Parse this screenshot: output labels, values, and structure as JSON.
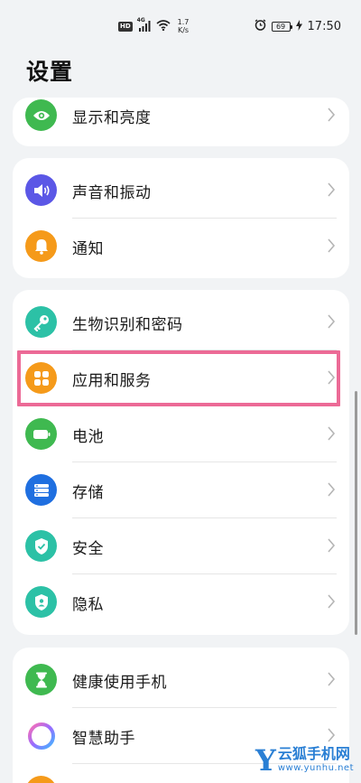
{
  "status_bar": {
    "hd_label": "HD",
    "network_tag": "4G",
    "speed_value": "1.7",
    "speed_unit": "K/s",
    "battery_level": "69",
    "time": "17:50"
  },
  "page_title": "设置",
  "cards": [
    {
      "items": [
        {
          "label": "显示和亮度",
          "icon": "eye-icon",
          "color": "#3fb950"
        }
      ]
    },
    {
      "items": [
        {
          "label": "声音和振动",
          "icon": "speaker-icon",
          "color": "#5b57e6"
        },
        {
          "label": "通知",
          "icon": "bell-icon",
          "color": "#f59a1a"
        }
      ]
    },
    {
      "items": [
        {
          "label": "生物识别和密码",
          "icon": "key-icon",
          "color": "#2cc1a6"
        },
        {
          "label": "应用和服务",
          "icon": "apps-grid-icon",
          "color": "#f59a1a"
        },
        {
          "label": "电池",
          "icon": "battery-icon",
          "color": "#3fb950"
        },
        {
          "label": "存储",
          "icon": "storage-icon",
          "color": "#1f6fe0"
        },
        {
          "label": "安全",
          "icon": "shield-check-icon",
          "color": "#2cc1a6"
        },
        {
          "label": "隐私",
          "icon": "privacy-shield-icon",
          "color": "#2cc1a6"
        }
      ]
    },
    {
      "items": [
        {
          "label": "健康使用手机",
          "icon": "hourglass-icon",
          "color": "#3fb950"
        },
        {
          "label": "智慧助手",
          "icon": "assistant-ring-icon",
          "color": "#ffffff"
        }
      ]
    }
  ],
  "highlighted_item": "应用和服务",
  "watermark": {
    "logo_letter": "Y",
    "name": "云狐手机网",
    "url": "www.yunhu.net"
  }
}
